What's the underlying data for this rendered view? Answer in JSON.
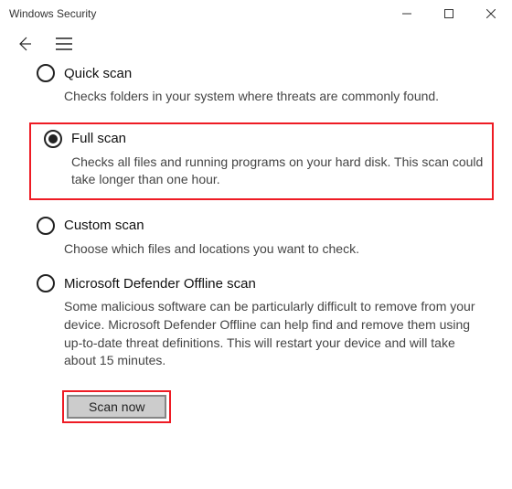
{
  "window": {
    "title": "Windows Security"
  },
  "options": {
    "quick": {
      "label": "Quick scan",
      "desc": "Checks folders in your system where threats are commonly found."
    },
    "full": {
      "label": "Full scan",
      "desc": "Checks all files and running programs on your hard disk. This scan could take longer than one hour."
    },
    "custom": {
      "label": "Custom scan",
      "desc": "Choose which files and locations you want to check."
    },
    "offline": {
      "label": "Microsoft Defender Offline scan",
      "desc": "Some malicious software can be particularly difficult to remove from your device. Microsoft Defender Offline can help find and remove them using up-to-date threat definitions. This will restart your device and will take about 15 minutes."
    },
    "selected": "full"
  },
  "actions": {
    "scan": "Scan now"
  }
}
